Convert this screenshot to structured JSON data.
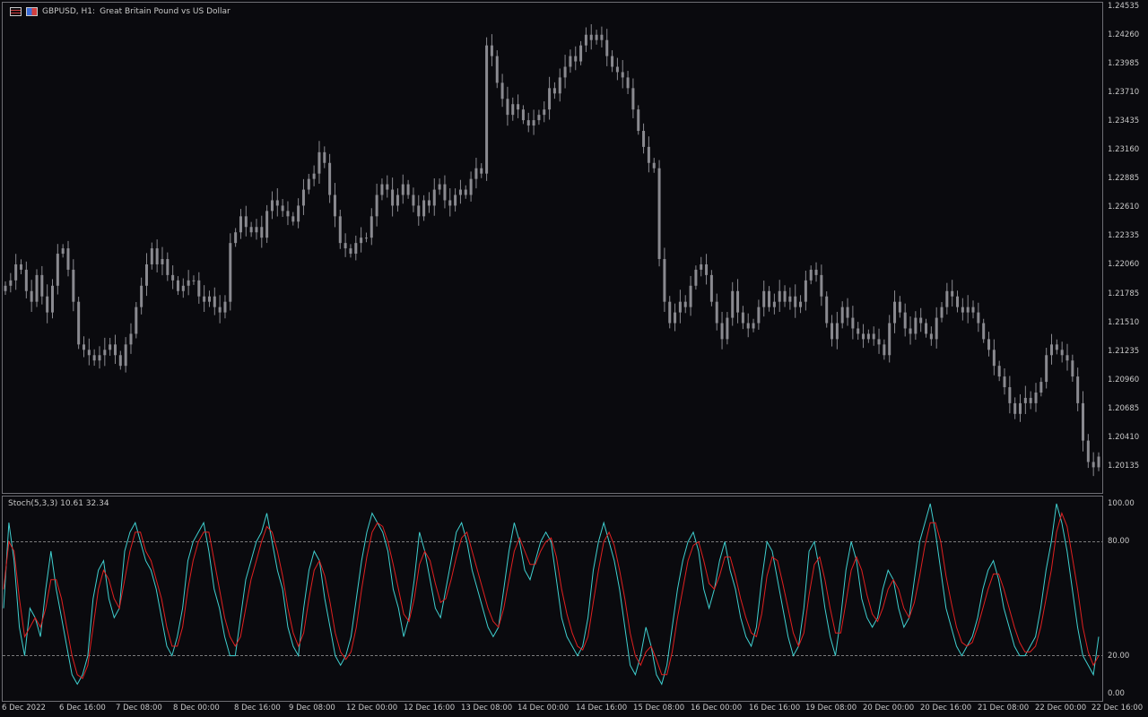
{
  "header": {
    "symbol": "GBPUSD, H1:",
    "description": "Great Britain Pound vs US Dollar",
    "icons": [
      "menu-icon",
      "chart-flag-icon"
    ]
  },
  "price_axis": [
    "1.24535",
    "1.24260",
    "1.23985",
    "1.23710",
    "1.23435",
    "1.23160",
    "1.22885",
    "1.22610",
    "1.22335",
    "1.22060",
    "1.21785",
    "1.21510",
    "1.21235",
    "1.20960",
    "1.20685",
    "1.20410",
    "1.20135"
  ],
  "indicator": {
    "label": "Stoch(5,3,3) 10.61 32.34",
    "axis": [
      "100.00",
      "80.00",
      "20.00",
      "0.00"
    ],
    "main_color": "#3fcfcf",
    "signal_color": "#e02020"
  },
  "time_axis": [
    "6 Dec 2022",
    "6 Dec 16:00",
    "7 Dec 08:00",
    "8 Dec 00:00",
    "8 Dec 16:00",
    "9 Dec 08:00",
    "12 Dec 00:00",
    "12 Dec 16:00",
    "13 Dec 08:00",
    "14 Dec 00:00",
    "14 Dec 16:00",
    "15 Dec 08:00",
    "16 Dec 00:00",
    "16 Dec 16:00",
    "19 Dec 08:00",
    "20 Dec 00:00",
    "20 Dec 16:00",
    "21 Dec 08:00",
    "22 Dec 00:00",
    "22 Dec 16:00"
  ],
  "colors": {
    "background": "#0a0a0e",
    "candles": "#8a8a90",
    "grid_level": "#a0a0a0"
  },
  "chart_data": [
    {
      "type": "candlestick",
      "title": "GBPUSD, H1: Great Britain Pound vs US Dollar",
      "ylim": [
        1.2001,
        1.246
      ],
      "x_range": [
        "6 Dec 2022",
        "22 Dec 16:00"
      ],
      "close": [
        1.2195,
        1.22,
        1.2215,
        1.221,
        1.219,
        1.218,
        1.2205,
        1.2185,
        1.217,
        1.2195,
        1.2225,
        1.223,
        1.221,
        1.218,
        1.214,
        1.2135,
        1.213,
        1.2125,
        1.213,
        1.2135,
        1.214,
        1.213,
        1.212,
        1.214,
        1.215,
        1.2175,
        1.2195,
        1.2215,
        1.223,
        1.2215,
        1.222,
        1.2205,
        1.22,
        1.219,
        1.2195,
        1.22,
        1.22,
        1.2185,
        1.218,
        1.2185,
        1.2175,
        1.217,
        1.218,
        1.2235,
        1.2245,
        1.226,
        1.225,
        1.2245,
        1.225,
        1.224,
        1.2265,
        1.2275,
        1.227,
        1.2265,
        1.226,
        1.2255,
        1.227,
        1.2285,
        1.2295,
        1.23,
        1.232,
        1.231,
        1.228,
        1.226,
        1.2235,
        1.223,
        1.2225,
        1.2235,
        1.224,
        1.224,
        1.226,
        1.228,
        1.229,
        1.2285,
        1.227,
        1.228,
        1.229,
        1.228,
        1.227,
        1.226,
        1.2275,
        1.227,
        1.2285,
        1.229,
        1.2275,
        1.227,
        1.228,
        1.2285,
        1.228,
        1.2295,
        1.2305,
        1.23,
        1.242,
        1.241,
        1.2385,
        1.237,
        1.2355,
        1.2365,
        1.236,
        1.235,
        1.2345,
        1.235,
        1.2355,
        1.236,
        1.238,
        1.2375,
        1.239,
        1.24,
        1.241,
        1.2405,
        1.242,
        1.243,
        1.2425,
        1.243,
        1.2425,
        1.241,
        1.24,
        1.2395,
        1.239,
        1.238,
        1.236,
        1.234,
        1.2325,
        1.231,
        1.2305,
        1.222,
        1.218,
        1.216,
        1.217,
        1.218,
        1.2175,
        1.2195,
        1.221,
        1.2215,
        1.2205,
        1.218,
        1.216,
        1.2145,
        1.2165,
        1.219,
        1.217,
        1.216,
        1.2155,
        1.216,
        1.2175,
        1.219,
        1.2175,
        1.218,
        1.219,
        1.218,
        1.2185,
        1.2175,
        1.218,
        1.22,
        1.221,
        1.2205,
        1.2185,
        1.216,
        1.2145,
        1.216,
        1.2175,
        1.2165,
        1.2155,
        1.215,
        1.2145,
        1.215,
        1.2145,
        1.214,
        1.213,
        1.216,
        1.218,
        1.217,
        1.2155,
        1.215,
        1.2165,
        1.216,
        1.215,
        1.2145,
        1.2165,
        1.2175,
        1.219,
        1.2185,
        1.2175,
        1.217,
        1.2175,
        1.217,
        1.216,
        1.2145,
        1.2135,
        1.212,
        1.211,
        1.21,
        1.2085,
        1.2075,
        1.2085,
        1.209,
        1.2085,
        1.2095,
        1.2105,
        1.213,
        1.214,
        1.2135,
        1.213,
        1.2125,
        1.211,
        1.2085,
        1.205,
        1.203,
        1.2025,
        1.2035
      ]
    },
    {
      "type": "line",
      "title": "Stoch(5,3,3) 10.61 32.34",
      "ylim": [
        0,
        100
      ],
      "levels": [
        80,
        20
      ],
      "series": [
        {
          "name": "Main",
          "values": [
            45,
            90,
            70,
            35,
            20,
            45,
            40,
            30,
            55,
            75,
            55,
            40,
            25,
            10,
            5,
            10,
            20,
            50,
            65,
            70,
            50,
            40,
            45,
            75,
            85,
            90,
            80,
            70,
            65,
            55,
            40,
            25,
            20,
            30,
            45,
            70,
            80,
            85,
            90,
            75,
            55,
            45,
            30,
            20,
            20,
            40,
            60,
            70,
            80,
            85,
            95,
            80,
            65,
            55,
            35,
            25,
            20,
            45,
            65,
            75,
            70,
            50,
            35,
            20,
            15,
            20,
            30,
            50,
            70,
            85,
            95,
            90,
            85,
            75,
            55,
            45,
            30,
            40,
            60,
            85,
            75,
            60,
            45,
            40,
            55,
            70,
            85,
            90,
            80,
            65,
            55,
            45,
            35,
            30,
            35,
            55,
            75,
            90,
            80,
            65,
            60,
            70,
            80,
            85,
            80,
            60,
            40,
            30,
            25,
            20,
            25,
            40,
            65,
            80,
            90,
            80,
            70,
            55,
            35,
            15,
            10,
            20,
            35,
            25,
            10,
            5,
            15,
            35,
            55,
            70,
            80,
            85,
            75,
            55,
            45,
            55,
            70,
            80,
            65,
            55,
            40,
            30,
            25,
            35,
            60,
            80,
            75,
            60,
            45,
            30,
            20,
            25,
            45,
            75,
            80,
            65,
            45,
            30,
            20,
            40,
            65,
            80,
            70,
            50,
            40,
            35,
            40,
            55,
            65,
            60,
            45,
            35,
            40,
            60,
            80,
            90,
            100,
            85,
            65,
            45,
            35,
            25,
            20,
            25,
            30,
            40,
            55,
            65,
            70,
            60,
            45,
            35,
            25,
            20,
            20,
            25,
            30,
            45,
            65,
            80,
            100,
            90,
            75,
            55,
            35,
            20,
            15,
            10,
            30
          ]
        },
        {
          "name": "Signal",
          "values": [
            55,
            80,
            75,
            50,
            30,
            35,
            40,
            35,
            45,
            60,
            60,
            50,
            35,
            20,
            10,
            8,
            15,
            35,
            55,
            65,
            60,
            50,
            45,
            60,
            75,
            85,
            85,
            75,
            70,
            60,
            50,
            35,
            25,
            25,
            35,
            55,
            70,
            80,
            85,
            85,
            70,
            55,
            40,
            30,
            25,
            30,
            45,
            60,
            70,
            80,
            88,
            85,
            75,
            62,
            45,
            32,
            25,
            32,
            50,
            65,
            70,
            62,
            48,
            32,
            22,
            18,
            22,
            35,
            55,
            72,
            85,
            90,
            88,
            80,
            68,
            55,
            42,
            38,
            50,
            68,
            75,
            70,
            58,
            48,
            50,
            60,
            72,
            82,
            85,
            75,
            65,
            55,
            45,
            38,
            35,
            45,
            60,
            75,
            82,
            75,
            68,
            68,
            75,
            80,
            82,
            72,
            55,
            42,
            32,
            25,
            23,
            30,
            48,
            65,
            80,
            85,
            78,
            65,
            50,
            32,
            20,
            15,
            22,
            25,
            18,
            10,
            10,
            22,
            40,
            55,
            70,
            78,
            80,
            70,
            58,
            55,
            62,
            72,
            72,
            62,
            50,
            40,
            32,
            30,
            42,
            62,
            72,
            70,
            58,
            45,
            32,
            25,
            32,
            52,
            68,
            72,
            60,
            45,
            32,
            32,
            48,
            65,
            72,
            65,
            52,
            42,
            38,
            45,
            55,
            60,
            55,
            45,
            40,
            48,
            62,
            78,
            90,
            90,
            80,
            62,
            48,
            35,
            27,
            25,
            27,
            35,
            45,
            55,
            63,
            63,
            55,
            45,
            35,
            27,
            22,
            22,
            25,
            35,
            50,
            65,
            85,
            95,
            88,
            72,
            55,
            35,
            22,
            15,
            20
          ]
        }
      ]
    }
  ]
}
